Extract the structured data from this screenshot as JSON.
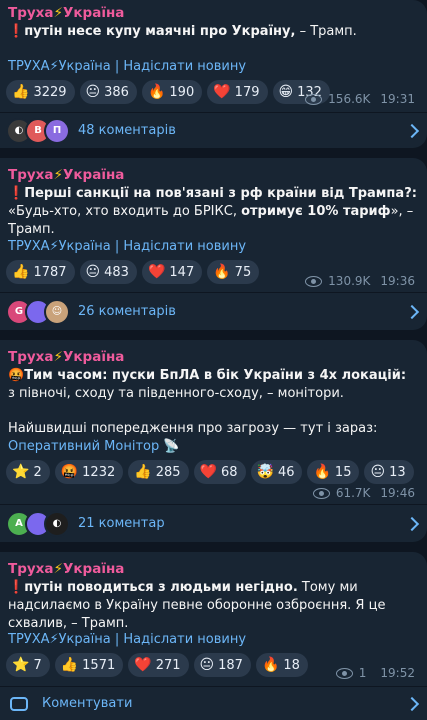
{
  "channel": {
    "name_prefix": "Труха",
    "bolt": "⚡",
    "name_suffix": "Україна"
  },
  "links": {
    "channel": "ТРУХА⚡Україна",
    "sep": "|",
    "submit": "Надіслати новину"
  },
  "posts": [
    {
      "icon": "❗",
      "text_bold": "путін несе купу маячні про Україну,",
      "text_rest": " – Трамп.",
      "reactions": [
        {
          "emoji": "👍",
          "count": "3229"
        },
        {
          "emoji": "😐",
          "count": "386"
        },
        {
          "emoji": "🔥",
          "count": "190"
        },
        {
          "emoji": "❤️",
          "count": "179"
        },
        {
          "emoji": "😁",
          "count": "132"
        }
      ],
      "views": "156.6K",
      "time": "19:31",
      "comments": "48 коментарів"
    },
    {
      "icon": "❗",
      "text_bold": "Перші санкції на пов'язані з рф країни від Трампа?:",
      "text_rest": " «Будь-хто, хто входить до БРІКС, ",
      "text_bold2": "отримує 10% тариф",
      "text_rest2": "», – Трамп.",
      "reactions": [
        {
          "emoji": "👍",
          "count": "1787"
        },
        {
          "emoji": "😐",
          "count": "483"
        },
        {
          "emoji": "❤️",
          "count": "147"
        },
        {
          "emoji": "🔥",
          "count": "75"
        }
      ],
      "views": "130.9K",
      "time": "19:36",
      "comments": "26 коментарів"
    },
    {
      "icon": "🤬",
      "text_bold": "Тим часом: пуски БпЛА в бік України з 4х локацій:",
      "text_rest": " з півночі, сходу та південного-сходу, – монітори.",
      "warning": "Найшвидші попередження про загрозу — тут і зараз:",
      "monitor_link": "Оперативний Монітор",
      "monitor_icon": "📡",
      "reactions": [
        {
          "emoji": "⭐",
          "count": "2"
        },
        {
          "emoji": "🤬",
          "count": "1232"
        },
        {
          "emoji": "👍",
          "count": "285"
        },
        {
          "emoji": "❤️",
          "count": "68"
        },
        {
          "emoji": "🤯",
          "count": "46"
        },
        {
          "emoji": "🔥",
          "count": "15"
        },
        {
          "emoji": "😐",
          "count": "13"
        }
      ],
      "views": "61.7K",
      "time": "19:46",
      "comments": "21 коментар"
    },
    {
      "icon": "❗",
      "text_bold": "путін поводиться з людьми негідно.",
      "text_rest": " Тому ми надсилаємо в Україну певне оборонне озброєння. Я це схвалив, – Трамп.",
      "reactions": [
        {
          "emoji": "⭐",
          "count": "7"
        },
        {
          "emoji": "👍",
          "count": "1571"
        },
        {
          "emoji": "❤️",
          "count": "271"
        },
        {
          "emoji": "😐",
          "count": "187"
        },
        {
          "emoji": "🔥",
          "count": "18"
        }
      ],
      "views": "1",
      "time": "19:52",
      "comments": "Коментувати"
    }
  ],
  "colors": {
    "background": "#0e1621",
    "bubble": "#182533",
    "channel": "#ef5b9c",
    "link": "#6cb6f7"
  }
}
